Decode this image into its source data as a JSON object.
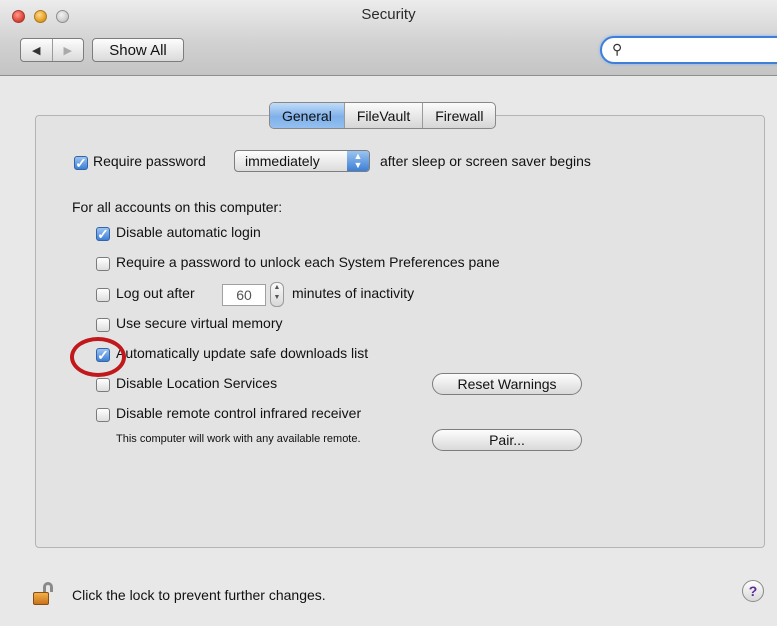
{
  "window": {
    "title": "Security"
  },
  "toolbar": {
    "back_glyph": "◀",
    "forward_glyph": "▶",
    "show_all_label": "Show All",
    "search_icon_glyph": "🔍",
    "search_value": ""
  },
  "tabs": [
    {
      "label": "General",
      "active": true
    },
    {
      "label": "FileVault",
      "active": false
    },
    {
      "label": "Firewall",
      "active": false
    }
  ],
  "general": {
    "require_password": {
      "checked": true,
      "label": "Require password",
      "popup_value": "immediately",
      "suffix": "after sleep or screen saver begins"
    },
    "all_accounts_heading": "For all accounts on this computer:",
    "options": {
      "disable_auto_login": {
        "checked": true,
        "label": "Disable automatic login"
      },
      "require_pw_prefs": {
        "checked": false,
        "label": "Require a password to unlock each System Preferences pane"
      },
      "logout_after": {
        "checked": false,
        "label": "Log out after",
        "minutes": "60",
        "suffix": "minutes of inactivity"
      },
      "secure_vm": {
        "checked": false,
        "label": "Use secure virtual memory"
      },
      "auto_update_downloads": {
        "checked": true,
        "label": "Automatically update safe downloads list"
      },
      "disable_location": {
        "checked": false,
        "label": "Disable Location Services"
      },
      "disable_ir": {
        "checked": false,
        "label": "Disable remote control infrared receiver"
      }
    },
    "ir_note": "This computer will work with any available remote.",
    "reset_warnings_label": "Reset Warnings",
    "pair_label": "Pair..."
  },
  "footer": {
    "lock_text": "Click the lock to prevent further changes.",
    "help_glyph": "?"
  },
  "colors": {
    "accent": "#3d7fd6",
    "highlight_ring": "#c0181b"
  }
}
